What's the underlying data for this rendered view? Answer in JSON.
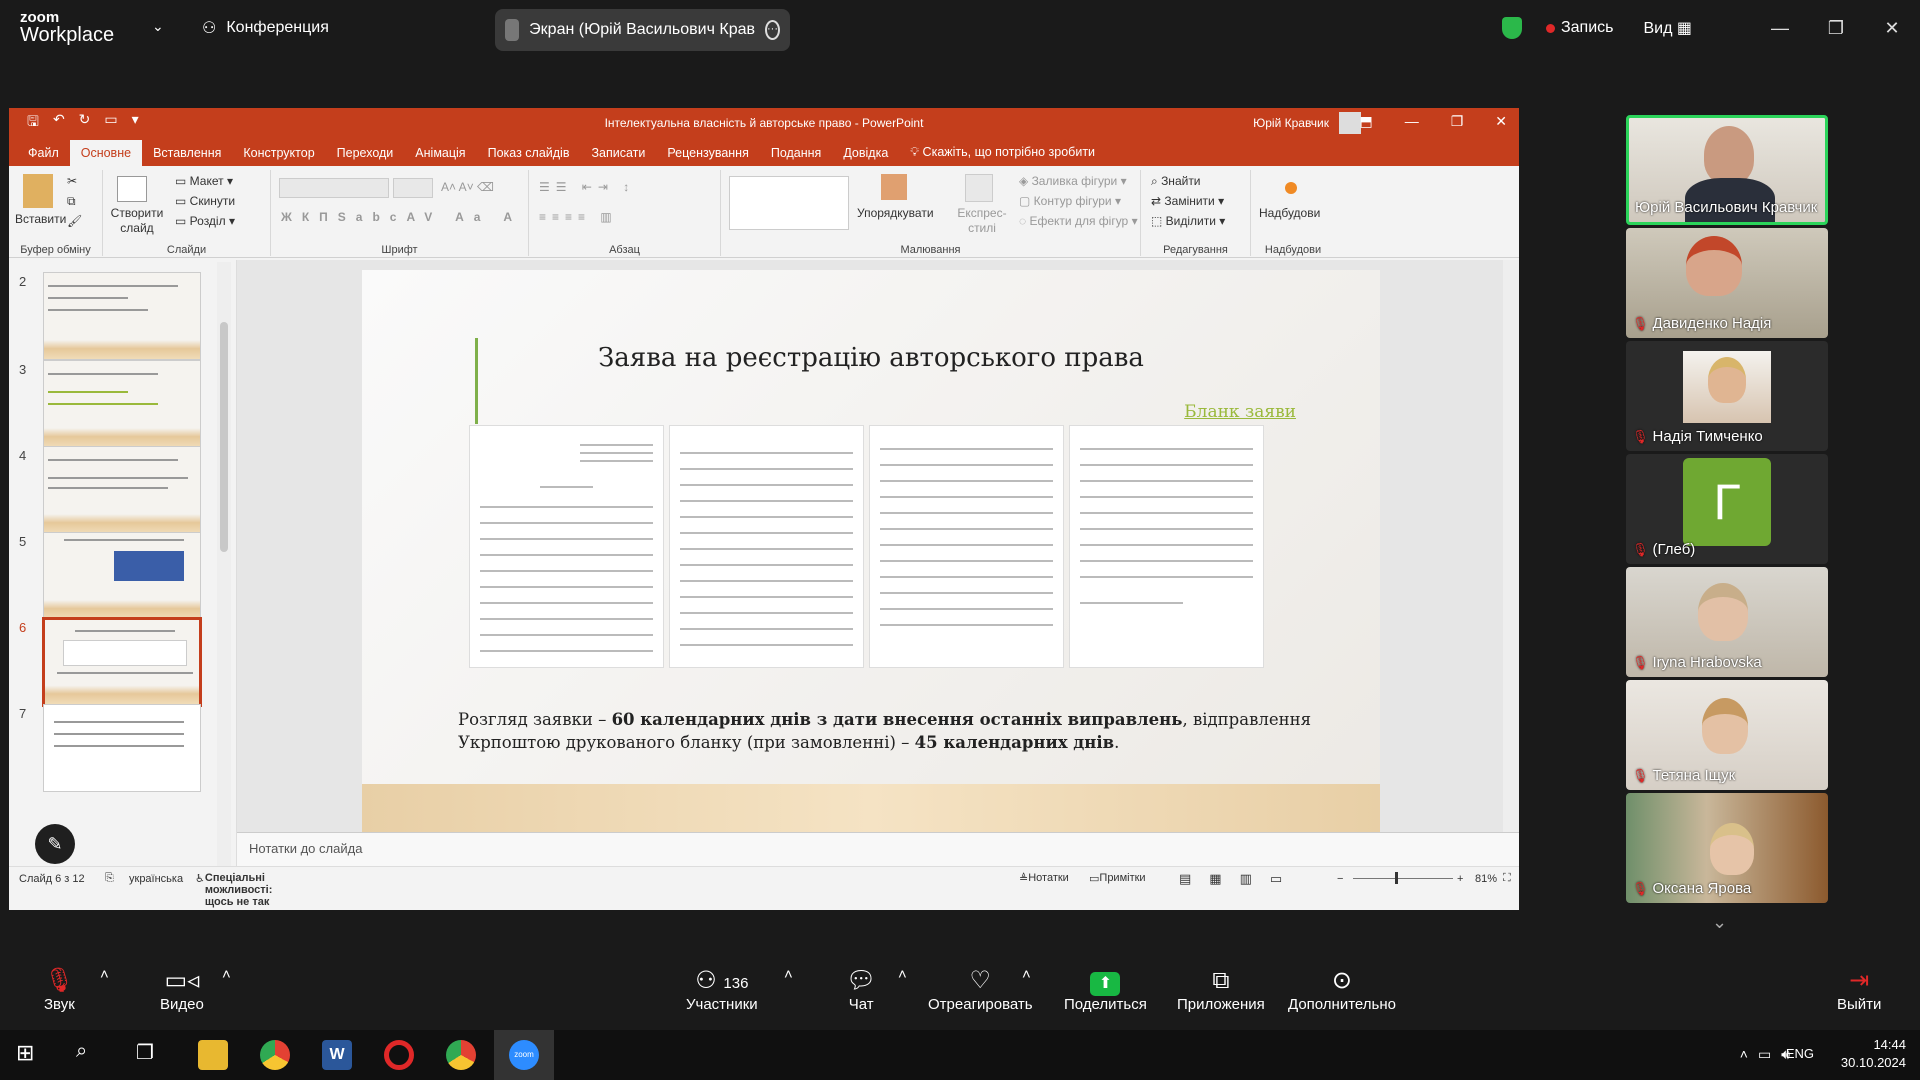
{
  "zoom": {
    "brand_line1": "zoom",
    "brand_line2": "Workplace",
    "meeting_label": "Конференция",
    "screen_share_label": "Экран (Юрій Васильович Крав",
    "record_label": "Запись",
    "view_label": "Вид"
  },
  "ppt": {
    "window_title": "Інтелектуальна власність й авторське право  -  PowerPoint",
    "user": "Юрій Кравчик",
    "tabs": [
      "Файл",
      "Основне",
      "Вставлення",
      "Конструктор",
      "Переходи",
      "Анімація",
      "Показ слайдів",
      "Записати",
      "Рецензування",
      "Подання",
      "Довідка"
    ],
    "tell_me": "Скажіть, що потрібно зробити",
    "ribbon": {
      "paste": "Вставити",
      "clipboard": "Буфер обміну",
      "new_slide": "Створити слайд",
      "layout": "Макет",
      "reset": "Скинути",
      "section": "Розділ",
      "slides": "Слайди",
      "font": "Шрифт",
      "paragraph": "Абзац",
      "arrange": "Упорядкувати",
      "quick_styles": "Експрес-стилі",
      "shape_fill": "Заливка фігури",
      "shape_outline": "Контур фігури",
      "shape_effects": "Ефекти для фігур",
      "drawing": "Малювання",
      "find": "Знайти",
      "replace": "Замінити",
      "select": "Виділити",
      "editing": "Редагування",
      "addins_btn": "Надбудови",
      "addins": "Надбудови"
    },
    "thumb_numbers": [
      "2",
      "3",
      "4",
      "5",
      "6",
      "7"
    ],
    "slide": {
      "title": "Заява на реєстрацію авторського права",
      "link": "Бланк заяви",
      "body_p1": "Розгляд заявки – ",
      "body_b1": "60 календарних днів з дати внесення останніх виправлень",
      "body_p2": ", відправлення Укрпоштою друкованого бланку (при замовленні) – ",
      "body_b2": "45 календарних днів",
      "body_p3": "."
    },
    "notes_placeholder": "Нотатки до слайда",
    "status": {
      "slide_count": "Слайд 6 з 12",
      "language": "українська",
      "accessibility": "Спеціальні можливості: щось не так",
      "notes": "Нотатки",
      "comments": "Примітки",
      "zoom": "81%"
    }
  },
  "participants": [
    {
      "name": "Юрій Васильович Кравчик"
    },
    {
      "name": "Давиденко Надія"
    },
    {
      "name": "Надія Тимченко"
    },
    {
      "name": "(Глеб)",
      "initial": "Г"
    },
    {
      "name": "Iryna  Hrabovska"
    },
    {
      "name": "Тетяна Іщук"
    },
    {
      "name": "Оксана Ярова"
    }
  ],
  "toolbar": {
    "audio": "Звук",
    "video": "Видео",
    "participants": "Участники",
    "participants_count": "136",
    "chat": "Чат",
    "react": "Отреагировать",
    "share": "Поделиться",
    "apps": "Приложения",
    "more": "Дополнительно",
    "leave": "Выйти"
  },
  "taskbar": {
    "lang": "ENG",
    "time": "14:44",
    "date": "30.10.2024"
  },
  "colors": {
    "ppt_accent": "#c43e1c",
    "active_speaker": "#2bd45a",
    "share_green": "#18b843",
    "muted": "#e02828"
  }
}
